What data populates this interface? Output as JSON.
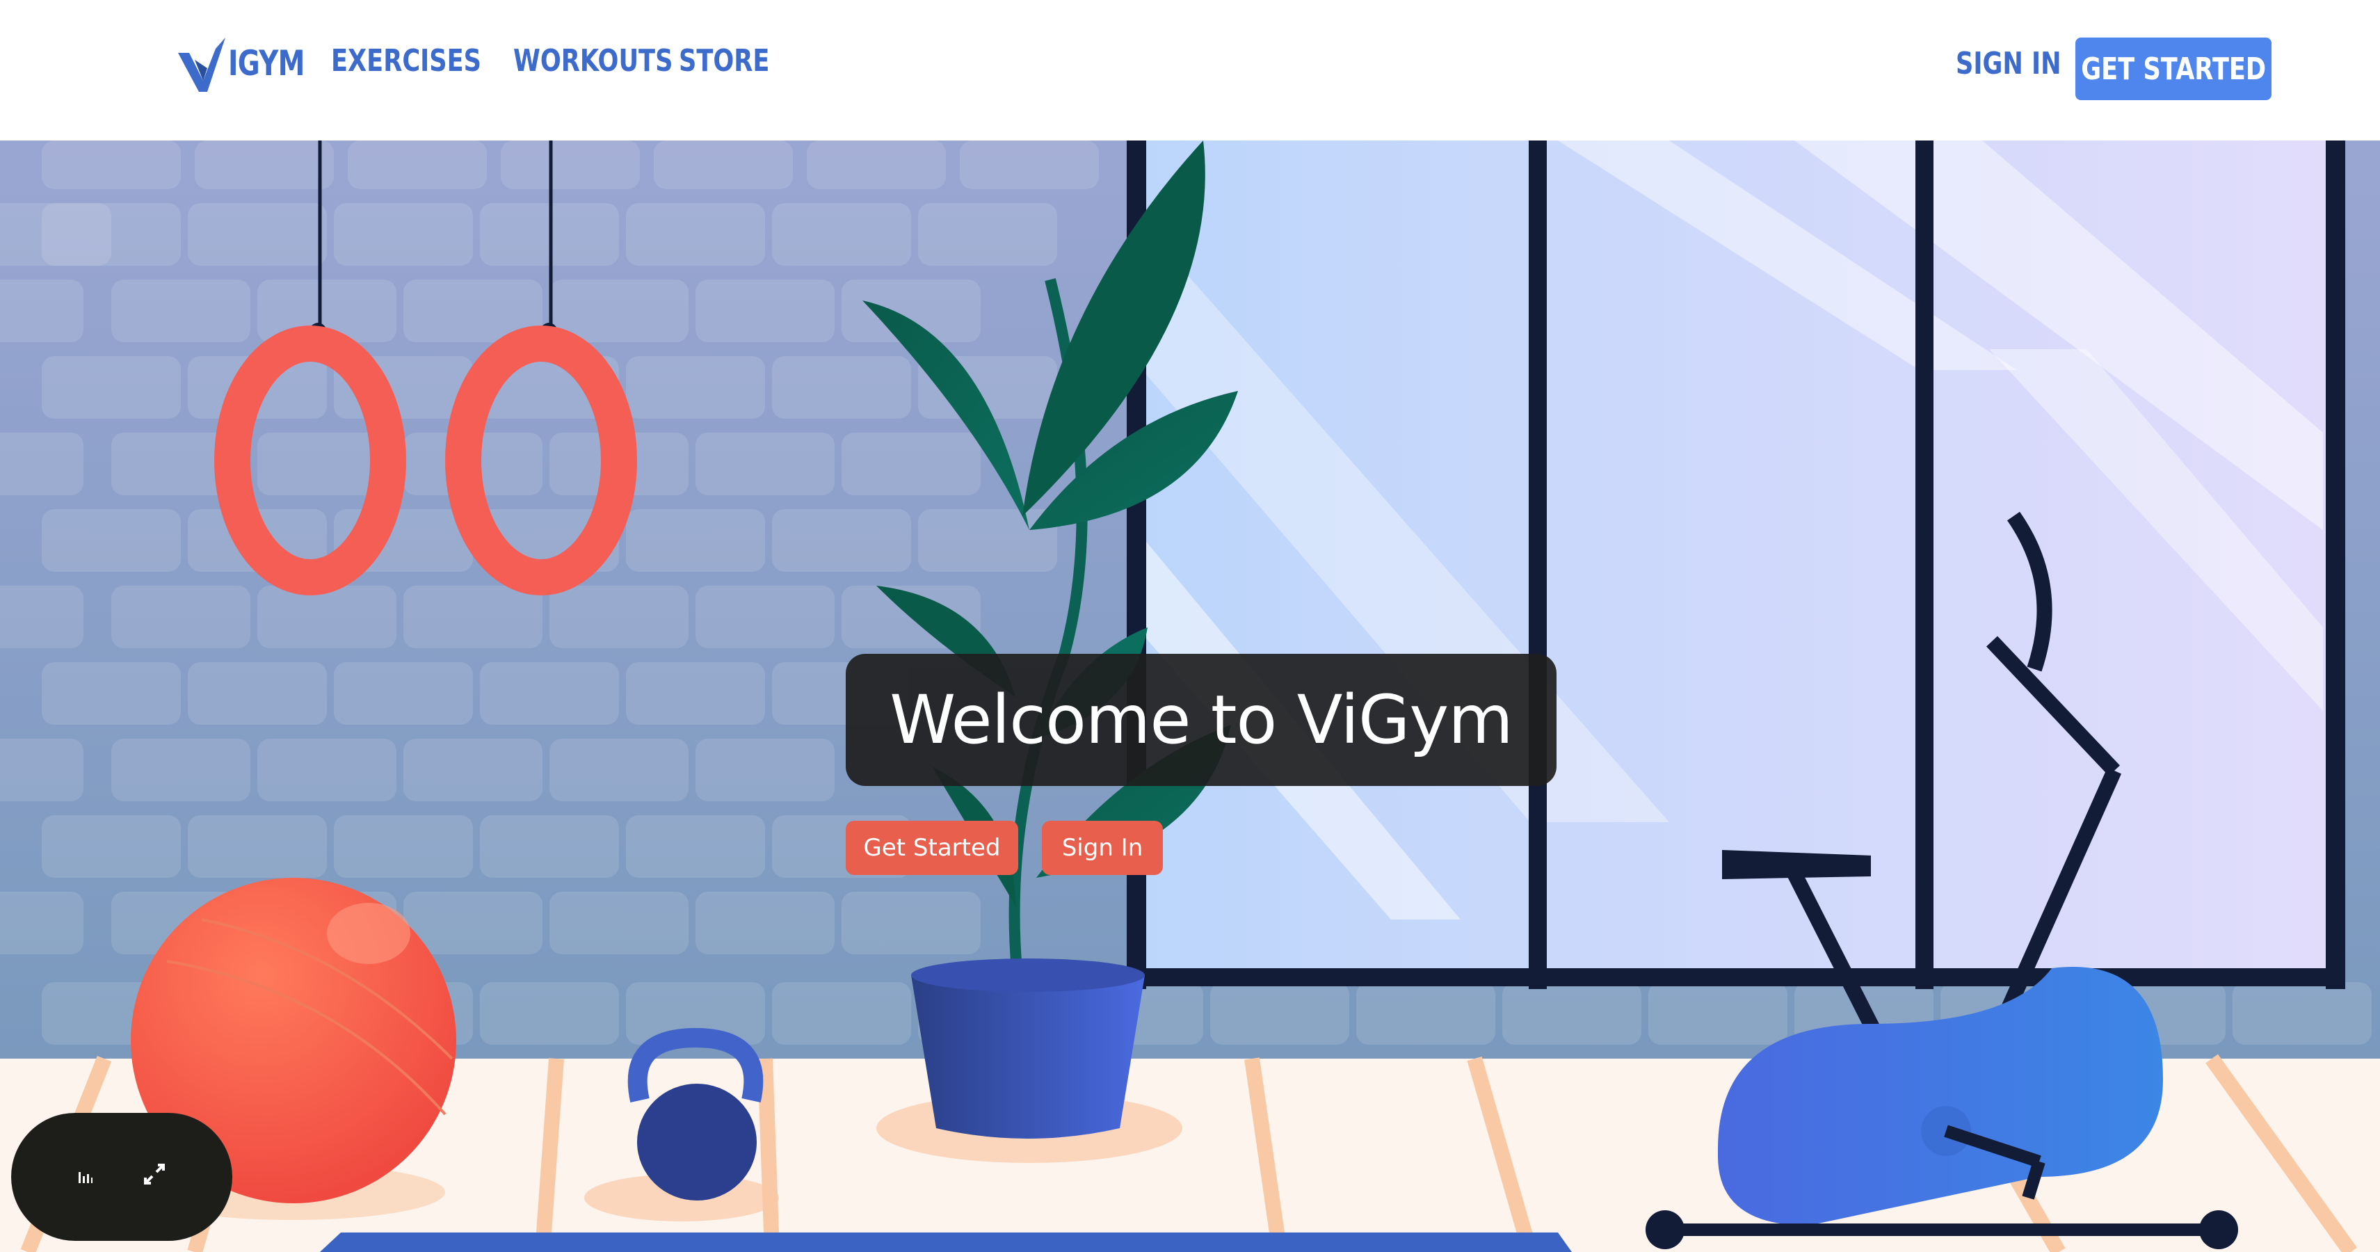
{
  "brand": {
    "logo_text": "IGYM",
    "logo_mark": "V"
  },
  "nav": {
    "items": [
      "EXERCISES",
      "WORKOUTS",
      "STORE"
    ]
  },
  "header_actions": {
    "sign_in": "SIGN IN",
    "get_started": "GET STARTED"
  },
  "hero": {
    "title": "Welcome to ViGym",
    "primary_button": "Get Started",
    "secondary_button": "Sign In"
  },
  "media_controls": {
    "icons": [
      "equalizer-icon",
      "expand-icon"
    ]
  },
  "colors": {
    "brand_blue": "#3d6bcc",
    "button_blue": "#4f86ee",
    "accent_red": "#e8604d",
    "brick_wall": "#8aa2c8",
    "floor": "#fdf4ee"
  }
}
